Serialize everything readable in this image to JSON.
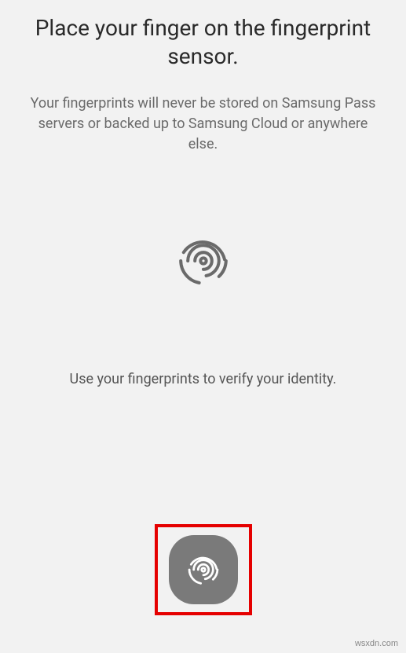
{
  "title": "Place your finger on the fingerprint sensor.",
  "subtitle": "Your fingerprints will never be stored on Samsung Pass servers or backed up to Samsung Cloud or anywhere else.",
  "instruction": "Use your fingerprints to verify your identity.",
  "watermark": "wsxdn.com"
}
